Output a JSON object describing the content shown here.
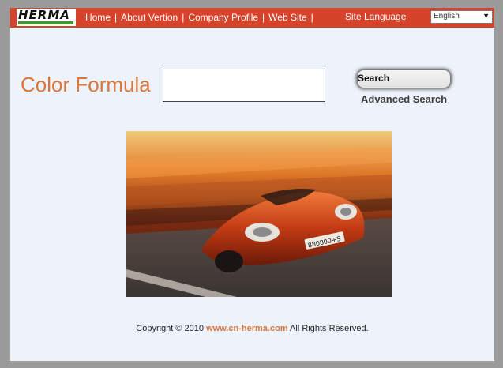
{
  "header": {
    "logo_text": "HERMA",
    "nav": [
      "Home",
      "About Vertion",
      "Company Profile",
      "Web Site"
    ],
    "separator": "|",
    "lang_label": "Site Language",
    "lang_value": "English"
  },
  "main": {
    "title": "Color Formula",
    "search_label": "Search",
    "advanced_search": "Advanced Search"
  },
  "footer": {
    "prefix": "Copyright © 2010 ",
    "site": "www.cn-herma.com",
    "suffix": " All Rights Reserved."
  },
  "colors": {
    "topbar": "#d4432a",
    "accent": "#d9763a",
    "page_bg": "#eef3fb"
  },
  "hero": {
    "plate_text": "880800+S"
  }
}
